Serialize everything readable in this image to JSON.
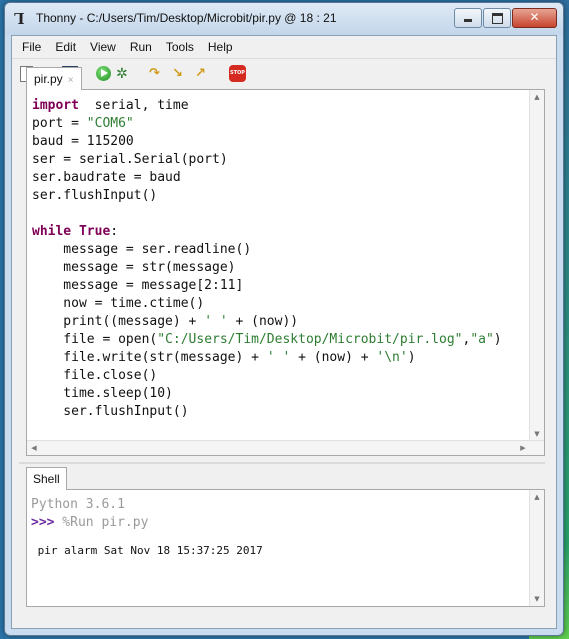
{
  "window": {
    "app_name": "Thonny",
    "title": "Thonny  -  C:/Users/Tim/Desktop/Microbit/pir.py  @  18 : 21",
    "close_glyph": "✕"
  },
  "menu": [
    "File",
    "Edit",
    "View",
    "Run",
    "Tools",
    "Help"
  ],
  "toolbar": {
    "icons": [
      "new-file-icon",
      "open-file-icon",
      "save-icon",
      "run-icon",
      "debug-icon",
      "step-over-icon",
      "step-into-icon",
      "step-out-icon",
      "stop-icon"
    ],
    "stop_label": "STOP"
  },
  "editor": {
    "tab_label": "pir.py",
    "tab_close": "×",
    "lines": [
      [
        [
          "kw",
          "import"
        ],
        [
          "",
          "  serial, time"
        ]
      ],
      [
        [
          "",
          "port = "
        ],
        [
          "str",
          "\"COM6\""
        ]
      ],
      [
        [
          "",
          "baud = 115200"
        ]
      ],
      [
        [
          "",
          "ser = serial.Serial(port)"
        ]
      ],
      [
        [
          "",
          "ser.baudrate = baud"
        ]
      ],
      [
        [
          "",
          "ser.flushInput()"
        ]
      ],
      [
        [
          "",
          ""
        ]
      ],
      [
        [
          "kw",
          "while"
        ],
        [
          "",
          ""
        ],
        [
          "kw",
          " True"
        ],
        [
          "",
          ":"
        ]
      ],
      [
        [
          "",
          "    message = ser.readline()"
        ]
      ],
      [
        [
          "",
          "    message = str(message)"
        ]
      ],
      [
        [
          "",
          "    message = message[2:11]"
        ]
      ],
      [
        [
          "",
          "    now = time.ctime()"
        ]
      ],
      [
        [
          "",
          "    print((message) + "
        ],
        [
          "str",
          "' '"
        ],
        [
          "",
          " + (now))"
        ]
      ],
      [
        [
          "",
          "    file = open("
        ],
        [
          "str",
          "\"C:/Users/Tim/Desktop/Microbit/pir.log\""
        ],
        [
          "",
          ","
        ],
        [
          "str",
          "\"a\""
        ],
        [
          "",
          ")"
        ]
      ],
      [
        [
          "",
          "    file.write(str(message) + "
        ],
        [
          "str",
          "' '"
        ],
        [
          "",
          " + (now) + "
        ],
        [
          "str",
          "'\\n'"
        ],
        [
          "",
          ")"
        ]
      ],
      [
        [
          "",
          "    file.close()"
        ]
      ],
      [
        [
          "",
          "    time.sleep(10)"
        ]
      ],
      [
        [
          "",
          "    ser.flushInput()"
        ]
      ]
    ]
  },
  "shell": {
    "tab_label": "Shell",
    "version": "Python 3.6.1",
    "prompt": ">>>",
    "command": " %Run pir.py",
    "output": " pir alarm Sat Nov 18 15:37:25 2017"
  },
  "colors": {
    "keyword": "#7f0055",
    "string": "#2e7d32",
    "prompt": "#6a2ba0"
  }
}
